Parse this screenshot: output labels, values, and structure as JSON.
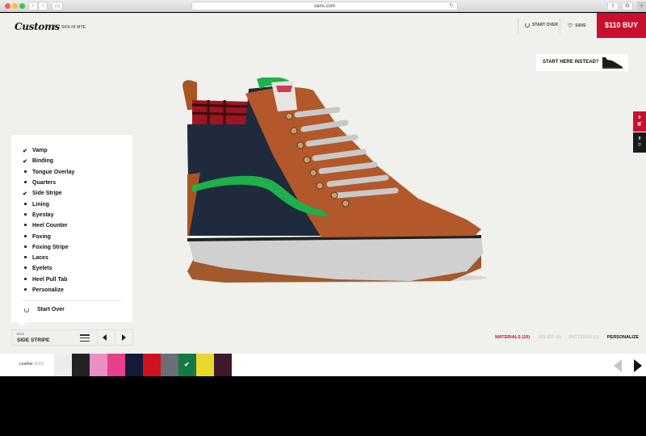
{
  "browser": {
    "url": "vans.com",
    "back_icon": "‹",
    "forward_icon": "›",
    "new_tab_icon": "+"
  },
  "header": {
    "brand": "Customs",
    "breadcrumb_sep": "/",
    "model": "SK8-HI MTE",
    "start_over_label": "START OVER",
    "save_label": "SAVE",
    "buy_label": "$110 BUY",
    "brand_color": "#c8102e"
  },
  "start_here": {
    "label": "START HERE INSTEAD?"
  },
  "side_tabs": {
    "cart_count": "0",
    "favorites_count": "0"
  },
  "menu": {
    "items": [
      {
        "label": "Vamp",
        "status": "done"
      },
      {
        "label": "Binding",
        "status": "done"
      },
      {
        "label": "Tongue Overlay",
        "status": "todo"
      },
      {
        "label": "Quarters",
        "status": "todo"
      },
      {
        "label": "Side Stripe",
        "status": "done"
      },
      {
        "label": "Lining",
        "status": "todo"
      },
      {
        "label": "Eyestay",
        "status": "todo"
      },
      {
        "label": "Heel Counter",
        "status": "todo"
      },
      {
        "label": "Foxing",
        "status": "todo"
      },
      {
        "label": "Foxing Stripe",
        "status": "todo"
      },
      {
        "label": "Laces",
        "status": "todo"
      },
      {
        "label": "Eyelets",
        "status": "todo"
      },
      {
        "label": "Heel Pull Tab",
        "status": "todo"
      },
      {
        "label": "Personalize",
        "status": "todo"
      }
    ],
    "start_over_label": "Start Over"
  },
  "step": {
    "count": "5/14",
    "name": "SIDE STRIPE"
  },
  "filters": {
    "tabs": [
      {
        "label": "MATERIALS (10)",
        "state": "active"
      },
      {
        "label": "SOLIDS (0)",
        "state": "disabled"
      },
      {
        "label": "PATTERNS (0)",
        "state": "disabled"
      },
      {
        "label": "PERSONALIZE",
        "state": "plain"
      }
    ]
  },
  "swatches": {
    "material": "Leather",
    "count": "(510)",
    "colors": [
      {
        "name": "white",
        "hex": "#ececec",
        "selected": false
      },
      {
        "name": "black",
        "hex": "#222222",
        "selected": false
      },
      {
        "name": "pink",
        "hex": "#e98fc4",
        "selected": false
      },
      {
        "name": "hot-pink",
        "hex": "#e83f8a",
        "selected": false
      },
      {
        "name": "navy",
        "hex": "#15193a",
        "selected": false
      },
      {
        "name": "red",
        "hex": "#cf121e",
        "selected": false
      },
      {
        "name": "gray",
        "hex": "#6c6d78",
        "selected": false
      },
      {
        "name": "green",
        "hex": "#127a44",
        "selected": true
      },
      {
        "name": "yellow",
        "hex": "#ead72b",
        "selected": false
      },
      {
        "name": "burgundy",
        "hex": "#3e1a2c",
        "selected": false
      }
    ],
    "check_icon": "✔"
  }
}
